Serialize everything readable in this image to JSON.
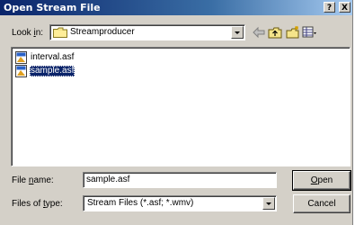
{
  "window": {
    "title": "Open Stream File",
    "help_btn": "?",
    "close_btn": "X"
  },
  "look_in": {
    "label_pre": "Look ",
    "label_accel": "i",
    "label_post": "n:",
    "value": "Streamproducer"
  },
  "files": [
    {
      "name": "interval.asf",
      "selected": false
    },
    {
      "name": "sample.asf",
      "selected": true
    }
  ],
  "file_name": {
    "label_pre": "File ",
    "label_accel": "n",
    "label_post": "ame:",
    "value": "sample.asf"
  },
  "files_of_type": {
    "label_pre": "Files of ",
    "label_accel": "t",
    "label_post": "ype:",
    "value": "Stream Files (*.asf; *.wmv)"
  },
  "buttons": {
    "open_accel": "O",
    "open_rest": "pen",
    "cancel": "Cancel"
  },
  "colors": {
    "title_bar": "#0a246a",
    "selection": "#0a246a",
    "dialog_bg": "#d4d0c8"
  },
  "icons": [
    "folder-icon",
    "back-arrow-icon",
    "up-folder-icon",
    "new-folder-icon",
    "view-menu-icon",
    "asf-file-icon"
  ]
}
